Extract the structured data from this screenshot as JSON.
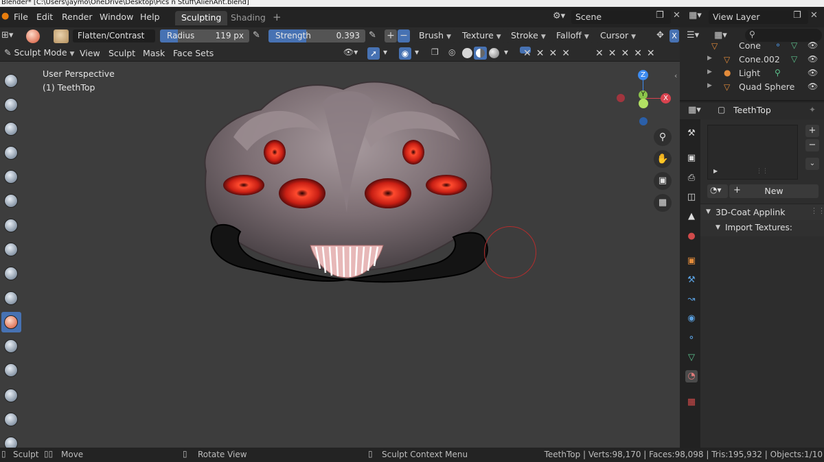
{
  "window": {
    "title": "Blender* [C:\\Users\\jaymo\\OneDrive\\Desktop\\Pics n Stuff\\AlienAnt.blend]"
  },
  "menu": [
    "File",
    "Edit",
    "Render",
    "Window",
    "Help"
  ],
  "workspaces": {
    "active": "Sculpting",
    "other": "Shading",
    "add": "+"
  },
  "scene": {
    "label": "Scene",
    "view_layer": "View Layer"
  },
  "tool_header": {
    "brush_name": "Flatten/Contrast",
    "radius_label": "Radius",
    "radius_value": "119 px",
    "radius_fraction": 0.2,
    "strength_label": "Strength",
    "strength_value": "0.393",
    "strength_fraction": 0.393,
    "plus": "+",
    "minus": "−",
    "dropdowns": [
      "Brush",
      "Texture",
      "Stroke",
      "Falloff",
      "Cursor"
    ],
    "x_btn": "X"
  },
  "mode_header": {
    "mode": "Sculpt Mode",
    "items": [
      "View",
      "Sculpt",
      "Mask",
      "Face Sets"
    ]
  },
  "viewport": {
    "perspective": "User Perspective",
    "object": "(1) TeethTop",
    "gizmo": {
      "z": "Z",
      "y": "Y",
      "x": "X"
    }
  },
  "outliner": {
    "rows": [
      {
        "name": "Cone",
        "icon": "cone-icon"
      },
      {
        "name": "Cone.002",
        "icon": "cone-icon"
      },
      {
        "name": "Light",
        "icon": "light-icon"
      },
      {
        "name": "Quad Sphere",
        "icon": "mesh-icon"
      }
    ]
  },
  "properties": {
    "object_name": "TeethTop",
    "new_button": "New",
    "panel_title": "3D-Coat Applink",
    "subpanel": "Import Textures:",
    "plus": "+",
    "minus": "−"
  },
  "status": {
    "left_items": [
      "Sculpt",
      "Move",
      "Rotate View",
      "Sculpt Context Menu"
    ],
    "stats": "TeethTop | Verts:98,170 | Faces:98,098 | Tris:195,932 | Objects:1/10"
  },
  "colors": {
    "accent": "#4772b3",
    "header": "#2b2b2b",
    "viewport": "#3d3d3d",
    "gizmo_x": "#d9434f",
    "gizmo_y": "#8bc34a",
    "gizmo_z": "#3d8bf0"
  }
}
